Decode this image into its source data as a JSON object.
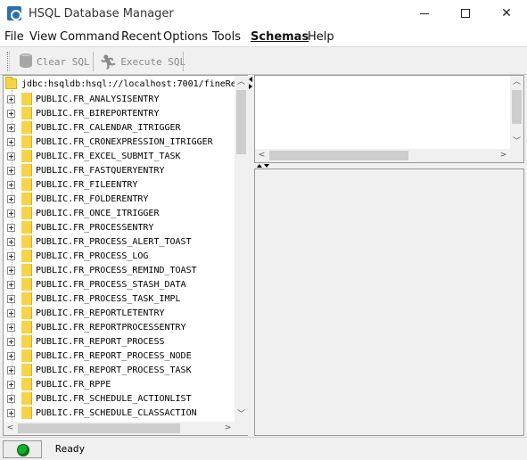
{
  "window": {
    "title": "HSQL Database Manager",
    "controls": {
      "minimize": "—",
      "maximize": "☐",
      "close": "✕"
    }
  },
  "menubar": {
    "items": [
      "File",
      "View",
      "Command",
      "Recent",
      "Options",
      "Tools",
      "Schemas",
      "Help"
    ],
    "active": "Schemas"
  },
  "toolbar": {
    "clear_sql": "Clear SQL",
    "execute_sql": "Execute SQL"
  },
  "tree": {
    "root": "jdbc:hsqldb:hsql://localhost:7001/fineRe",
    "items": [
      "PUBLIC.FR_ANALYSISENTRY",
      "PUBLIC.FR_BIREPORTENTRY",
      "PUBLIC.FR_CALENDAR_ITRIGGER",
      "PUBLIC.FR_CRONEXPRESSION_ITRIGGER",
      "PUBLIC.FR_EXCEL_SUBMIT_TASK",
      "PUBLIC.FR_FASTQUERYENTRY",
      "PUBLIC.FR_FILEENTRY",
      "PUBLIC.FR_FOLDERENTRY",
      "PUBLIC.FR_ONCE_ITRIGGER",
      "PUBLIC.FR_PROCESSENTRY",
      "PUBLIC.FR_PROCESS_ALERT_TOAST",
      "PUBLIC.FR_PROCESS_LOG",
      "PUBLIC.FR_PROCESS_REMIND_TOAST",
      "PUBLIC.FR_PROCESS_STASH_DATA",
      "PUBLIC.FR_PROCESS_TASK_IMPL",
      "PUBLIC.FR_REPORTLETENTRY",
      "PUBLIC.FR_REPORTPROCESSENTRY",
      "PUBLIC.FR_REPORT_PROCESS",
      "PUBLIC.FR_REPORT_PROCESS_NODE",
      "PUBLIC.FR_REPORT_PROCESS_TASK",
      "PUBLIC.FR_RPPE",
      "PUBLIC.FR_SCHEDULE_ACTIONLIST",
      "PUBLIC.FR_SCHEDULE_CLASSACTION"
    ]
  },
  "status": {
    "text": "Ready",
    "led_color": "#11b02a"
  }
}
